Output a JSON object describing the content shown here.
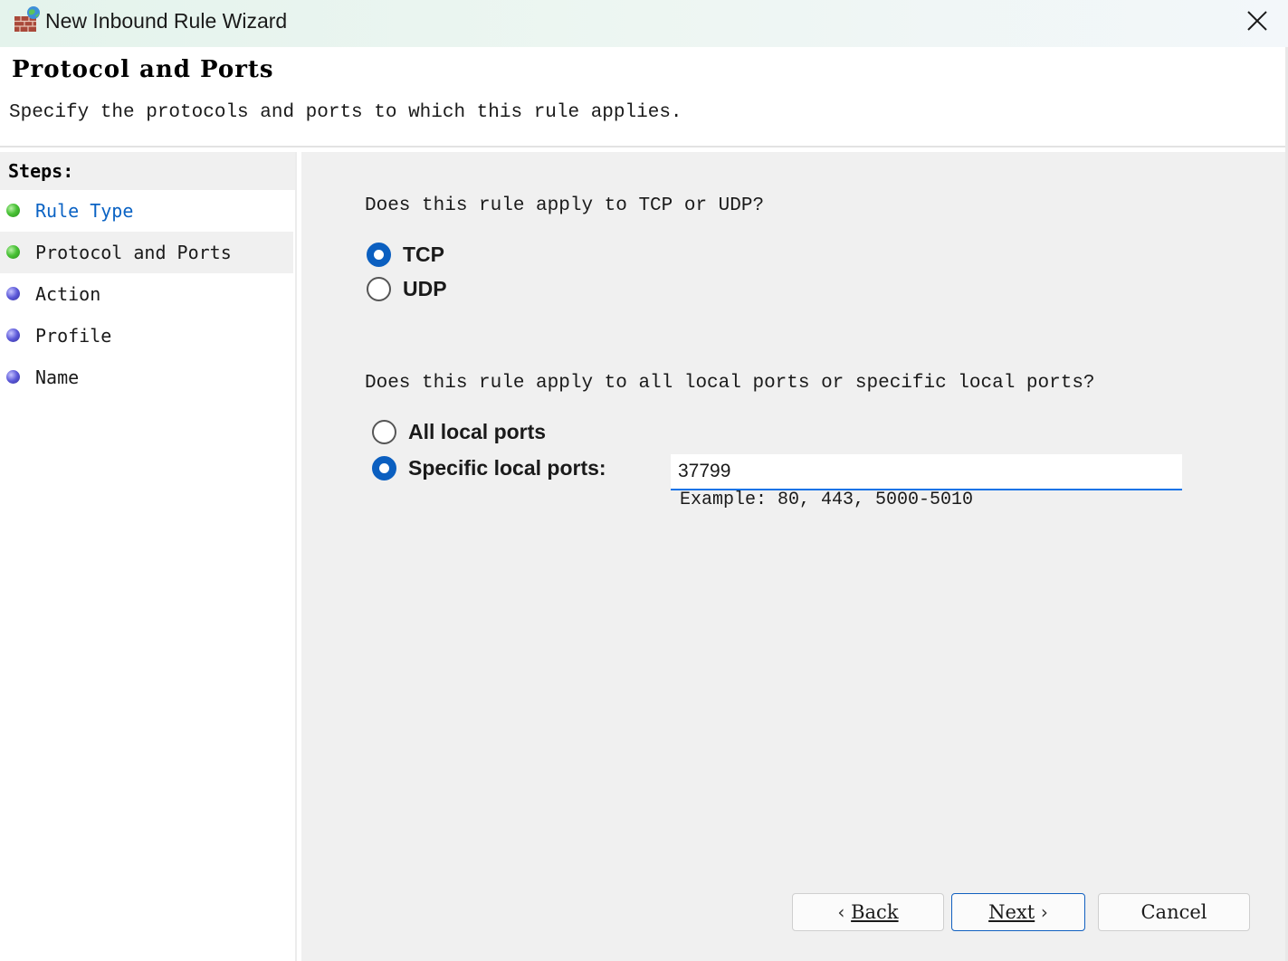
{
  "window": {
    "title": "New Inbound Rule Wizard"
  },
  "header": {
    "title": "Protocol and Ports",
    "subtitle": "Specify the protocols and ports to which this rule applies."
  },
  "steps": {
    "heading": "Steps:",
    "items": [
      {
        "label": "Rule Type",
        "status": "done",
        "link": true
      },
      {
        "label": "Protocol and Ports",
        "status": "done",
        "current": true
      },
      {
        "label": "Action",
        "status": "pending"
      },
      {
        "label": "Profile",
        "status": "pending"
      },
      {
        "label": "Name",
        "status": "pending"
      }
    ]
  },
  "protocol": {
    "question": "Does this rule apply to TCP or UDP?",
    "options": [
      {
        "label": "TCP",
        "checked": true
      },
      {
        "label": "UDP",
        "checked": false
      }
    ]
  },
  "ports": {
    "question": "Does this rule apply to all local ports or specific local ports?",
    "options": [
      {
        "label": "All local ports",
        "checked": false
      },
      {
        "label": "Specific local ports:",
        "checked": true
      }
    ],
    "value": "37799",
    "hint": "Example: 80, 443, 5000-5010"
  },
  "buttons": {
    "back_label": "Back",
    "next_label": "Next",
    "cancel_label": "Cancel"
  },
  "colors": {
    "accent": "#0b5fc0",
    "link": "#0b63c4",
    "content_bg": "#f0f0f0"
  }
}
